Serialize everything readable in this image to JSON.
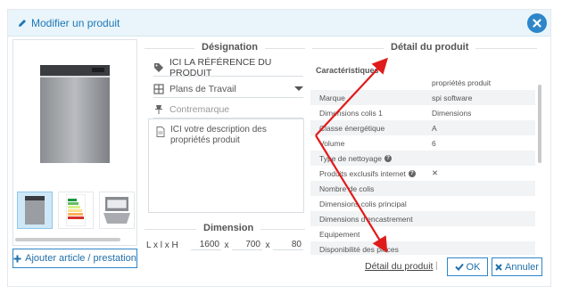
{
  "header": {
    "title": "Modifier un produit",
    "edit_icon": "pencil-icon",
    "close_icon": "close-icon",
    "accent_color": "#2e86c9"
  },
  "designation": {
    "section_title": "Désignation",
    "reference": "ICI LA RÉFÉRENCE DU PRODUIT",
    "reference_icon": "tag-icon",
    "category_value": "Plans de Travail",
    "category_icon": "grid-icon",
    "brand_placeholder": "Contremarque",
    "brand_icon": "pin-icon",
    "description": "ICI votre description des propriétés produit",
    "description_icon": "document-icon"
  },
  "dimension": {
    "section_title": "Dimension",
    "label": "L x l x H",
    "length": "1600",
    "width": "700",
    "height": "80",
    "separator": "x"
  },
  "details": {
    "section_title": "Détail du produit",
    "characteristics_label": "Caractéristiques",
    "rows": [
      {
        "name": "",
        "value": "propriétés produit",
        "help": false
      },
      {
        "name": "Marque",
        "value": "spi software",
        "help": false
      },
      {
        "name": "Dimensions colis 1",
        "value": "Dimensions",
        "help": false
      },
      {
        "name": "Classe énergétique",
        "value": "A",
        "help": false
      },
      {
        "name": "Volume",
        "value": "6",
        "help": false
      },
      {
        "name": "Type de nettoyage",
        "value": "",
        "help": true
      },
      {
        "name": "Produits exclusifs internet",
        "value": "✕",
        "help": true
      },
      {
        "name": "Nombre de colis",
        "value": "",
        "help": false
      },
      {
        "name": "Dimensions colis principal",
        "value": "",
        "help": false
      },
      {
        "name": "Dimensions d'encastrement",
        "value": "",
        "help": false
      },
      {
        "name": "Equipement",
        "value": "",
        "help": false
      },
      {
        "name": "Disponibilité des pièces",
        "value": "",
        "help": false
      }
    ]
  },
  "footer": {
    "add_button": "Ajouter article / prestation",
    "detail_link": "Détail du produit",
    "separator": "|",
    "ok_button": "OK",
    "cancel_button": "Annuler"
  }
}
